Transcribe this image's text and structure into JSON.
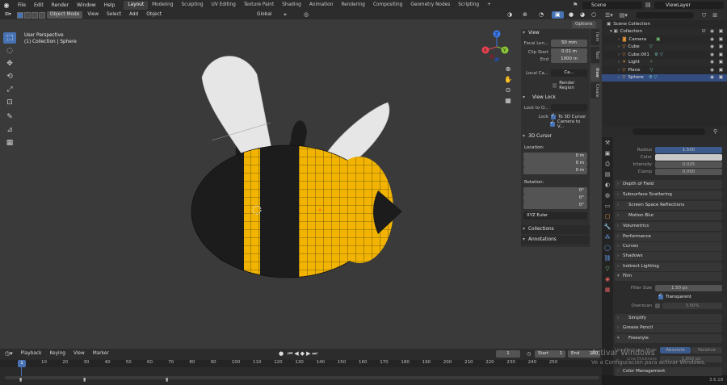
{
  "topbar": {
    "menus": [
      "File",
      "Edit",
      "Render",
      "Window",
      "Help"
    ],
    "workspaces": [
      "Layout",
      "Modeling",
      "Sculpting",
      "UV Editing",
      "Texture Paint",
      "Shading",
      "Animation",
      "Rendering",
      "Compositing",
      "Geometry Nodes",
      "Scripting"
    ],
    "active_workspace": "Layout",
    "scene": "Scene",
    "view_layer": "ViewLayer"
  },
  "viewport": {
    "mode": "Object Mode",
    "menus": [
      "View",
      "Select",
      "Add",
      "Object"
    ],
    "transform_orientation": "Global",
    "options_label": "Options",
    "title_line1": "User Perspective",
    "title_line2": "(1) Collection | Sphere",
    "background_color": "#3a3a3a",
    "bee_yellow": "#f2b400",
    "bee_black": "#1a1a1a",
    "wing_color": "#e8e8e8"
  },
  "npanel": {
    "tabs": [
      "Item",
      "Tool",
      "View",
      "Create"
    ],
    "active_tab": "View",
    "view_header": "View",
    "focal_length_label": "Focal Len...",
    "focal_length": "50 mm",
    "clip_start_label": "Clip Start",
    "clip_start": "0.01 m",
    "clip_end_label": "End",
    "clip_end": "1000 m",
    "local_camera_label": "Local Ca...",
    "local_camera_value": "Ca...",
    "render_region_label": "Render Region",
    "view_lock_header": "View Lock",
    "lock_to_object_label": "Lock to O...",
    "lock_label": "Lock",
    "to_3d_cursor": "To 3D Cursor",
    "camera_to_view": "Camera to V...",
    "cursor_header": "3D Cursor",
    "location_label": "Location:",
    "loc_x": "0 m",
    "loc_y": "0 m",
    "loc_z": "0 m",
    "rotation_label": "Rotation:",
    "rot_x": "0°",
    "rot_y": "0°",
    "rot_z": "0°",
    "rotation_mode": "XYZ Euler",
    "collections_header": "Collections",
    "annotations_header": "Annotations"
  },
  "outliner": {
    "items": [
      {
        "label": "Scene Collection"
      },
      {
        "label": "Collection"
      },
      {
        "label": "Camera"
      },
      {
        "label": "Cube"
      },
      {
        "label": "Cube.001"
      },
      {
        "label": "Light"
      },
      {
        "label": "Plane"
      },
      {
        "label": "Sphere"
      }
    ]
  },
  "properties": {
    "rows": [
      {
        "label": "Radius",
        "value": "1.500"
      },
      {
        "label": "Color",
        "value": ""
      },
      {
        "label": "Intensity",
        "value": "0.025"
      },
      {
        "label": "Clamp",
        "value": "0.000"
      }
    ],
    "sections": {
      "depth_of_field": "Depth of Field",
      "subsurface": "Subsurface Scattering",
      "ssr": "Screen Space Reflections",
      "motion_blur": "Motion Blur",
      "volumetrics": "Volumetrics",
      "performance": "Performance",
      "curves": "Curves",
      "shadows": "Shadows",
      "indirect": "Indirect Lighting",
      "film": "Film",
      "simplify": "Simplify",
      "grease_pencil": "Grease Pencil",
      "freestyle": "Freestyle",
      "color_management": "Color Management"
    },
    "filter_size_label": "Filter Size",
    "filter_size": "1.50 px",
    "transparent_label": "Transparent",
    "overscan_label": "Overscan",
    "overscan": "3.00%",
    "line_thickness_label": "Line Thickness Mode",
    "absolute": "Absolute",
    "relative": "Relative",
    "line_thickness2_label": "Line Thickness",
    "line_thickness2": "1.000 px"
  },
  "timeline": {
    "menus": [
      "Playback",
      "Keying",
      "View",
      "Marker"
    ],
    "current_frame": "1",
    "start_label": "Start",
    "start": "1",
    "end_label": "End",
    "end": "250",
    "ruler_frame": "1",
    "ticks": [
      "10",
      "20",
      "30",
      "40",
      "50",
      "60",
      "70",
      "80",
      "90",
      "100",
      "110",
      "120",
      "130",
      "140",
      "150",
      "160",
      "170",
      "180",
      "190",
      "200",
      "210",
      "220",
      "230",
      "240",
      "250"
    ]
  },
  "watermark_line1": "Activar Windows",
  "watermark_line2": "Ve a Configuración para activar Windows.",
  "version": "3.6.18"
}
